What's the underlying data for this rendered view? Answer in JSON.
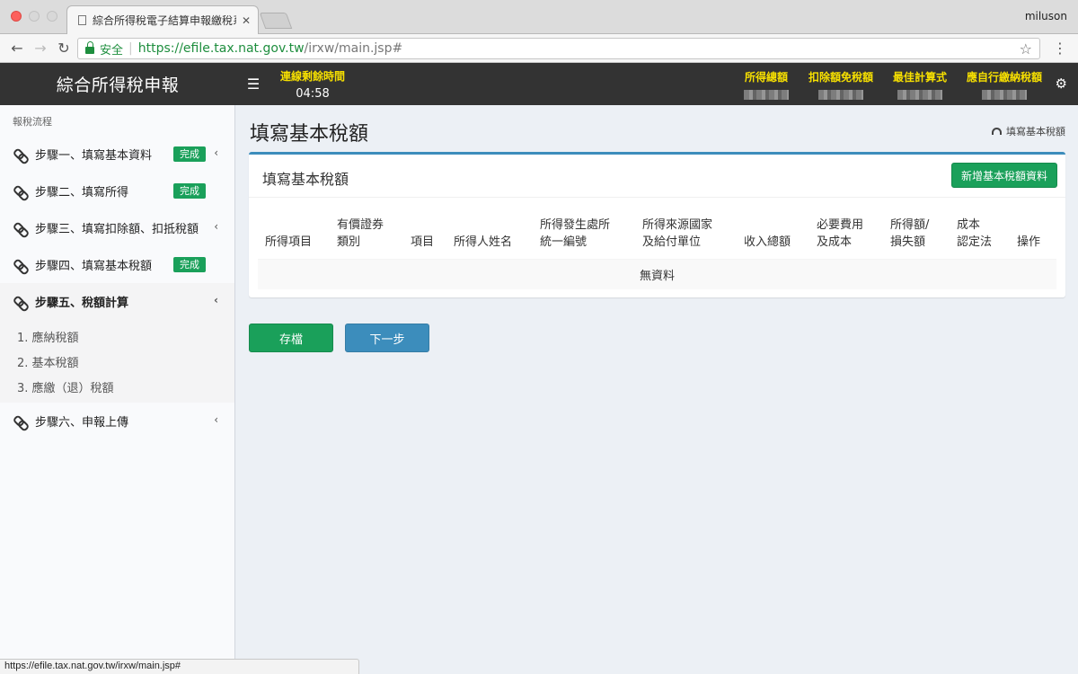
{
  "browser": {
    "tab_title": "綜合所得稅電子結算申報繳稅系統",
    "tab_close": "✕",
    "profile": "miluson",
    "secure_label": "安全",
    "url_host": "https://efile.tax.nat.gov.tw",
    "url_path": "/irxw/main.jsp#",
    "status_url": "https://efile.tax.nat.gov.tw/irxw/main.jsp#"
  },
  "header": {
    "logo": "綜合所得稅申報",
    "timer_label": "連線剩餘時間",
    "timer_value": "04:58",
    "summary": [
      "所得總額",
      "扣除額免稅額",
      "最佳計算式",
      "應自行繳納稅額"
    ]
  },
  "sidebar": {
    "header": "報稅流程",
    "steps": [
      {
        "label": "步驟一、填寫基本資料",
        "badge": "完成",
        "chevron": "‹"
      },
      {
        "label": "步驟二、填寫所得",
        "badge": "完成",
        "chevron": ""
      },
      {
        "label": "步驟三、填寫扣除額、扣抵稅額",
        "badge": "",
        "chevron": "‹"
      },
      {
        "label": "步驟四、填寫基本稅額",
        "badge": "完成",
        "chevron": ""
      },
      {
        "label": "步驟五、稅額計算",
        "badge": "",
        "chevron": "‹"
      },
      {
        "label": "步驟六、申報上傳",
        "badge": "",
        "chevron": "‹"
      }
    ],
    "subitems": [
      "1. 應納稅額",
      "2. 基本稅額",
      "3. 應繳（退）稅額"
    ]
  },
  "main": {
    "page_title": "填寫基本稅額",
    "breadcrumb": "填寫基本稅額",
    "box_title": "填寫基本稅額",
    "add_button": "新增基本稅額資料",
    "columns": [
      [
        "所得項目"
      ],
      [
        "有價證券",
        "類別"
      ],
      [
        "項目"
      ],
      [
        "所得人姓名"
      ],
      [
        "所得發生處所",
        "統一編號"
      ],
      [
        "所得來源國家",
        "及給付單位"
      ],
      [
        "收入總額"
      ],
      [
        "必要費用",
        "及成本"
      ],
      [
        "所得額/",
        "損失額"
      ],
      [
        "成本",
        "認定法"
      ],
      [
        "操作"
      ]
    ],
    "empty_text": "無資料",
    "save_button": "存檔",
    "next_button": "下一步"
  }
}
